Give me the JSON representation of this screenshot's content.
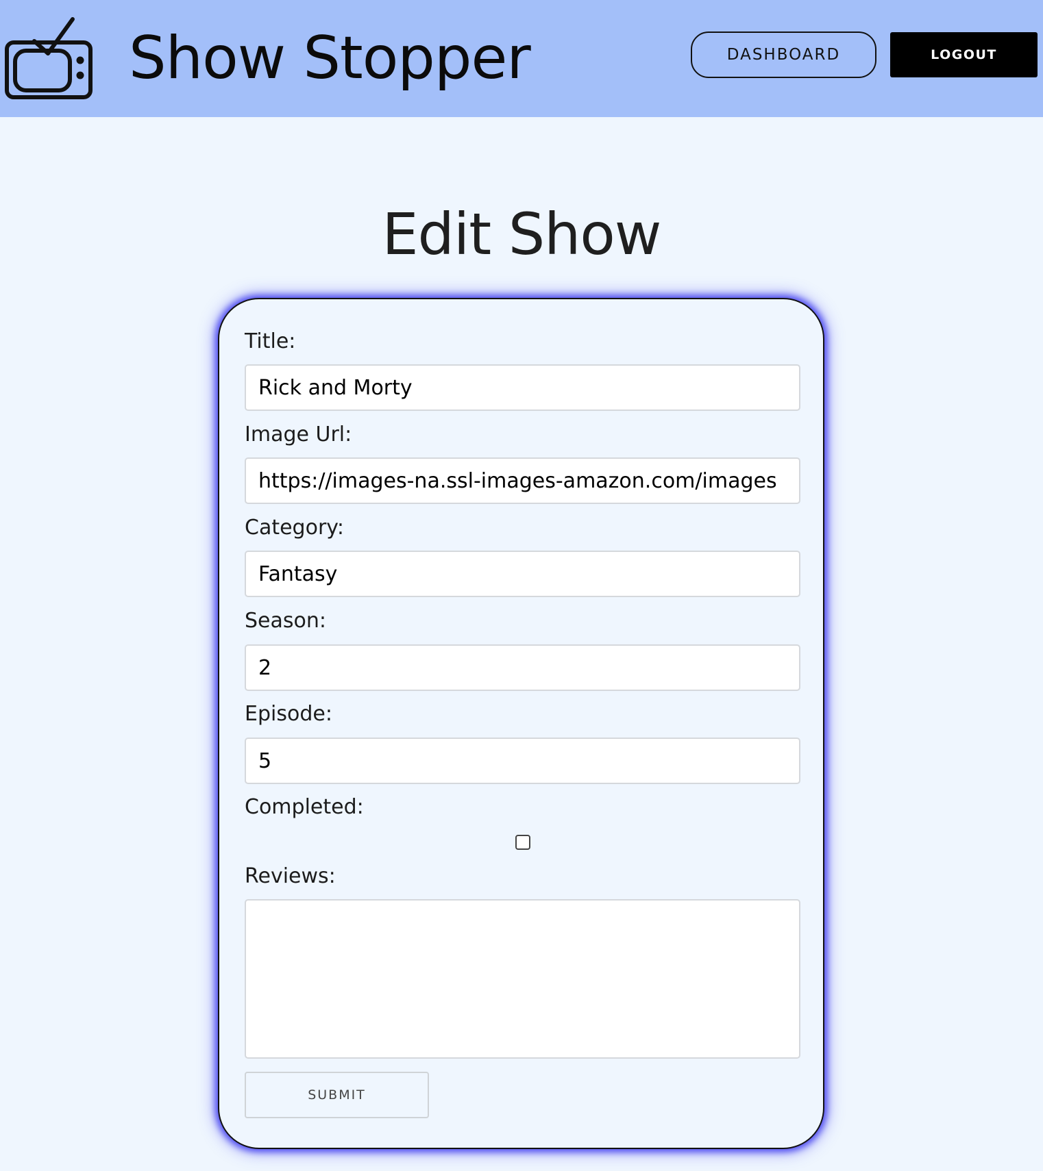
{
  "header": {
    "brand": "Show Stopper",
    "logo_icon": "tv-icon",
    "dashboard_label": "DASHBOARD",
    "logout_label": "LOGOUT"
  },
  "page": {
    "title": "Edit Show"
  },
  "form": {
    "title_label": "Title:",
    "title_value": "Rick and Morty",
    "image_url_label": "Image Url:",
    "image_url_value": "https://images-na.ssl-images-amazon.com/images",
    "category_label": "Category:",
    "category_value": "Fantasy",
    "season_label": "Season:",
    "season_value": "2",
    "episode_label": "Episode:",
    "episode_value": "5",
    "completed_label": "Completed:",
    "completed_checked": false,
    "reviews_label": "Reviews:",
    "reviews_value": "",
    "submit_label": "SUBMIT"
  },
  "colors": {
    "navbar_bg": "#a3bff9",
    "page_bg": "#eff6fe",
    "card_glow": "#4d4af0",
    "logout_bg": "#000000"
  }
}
